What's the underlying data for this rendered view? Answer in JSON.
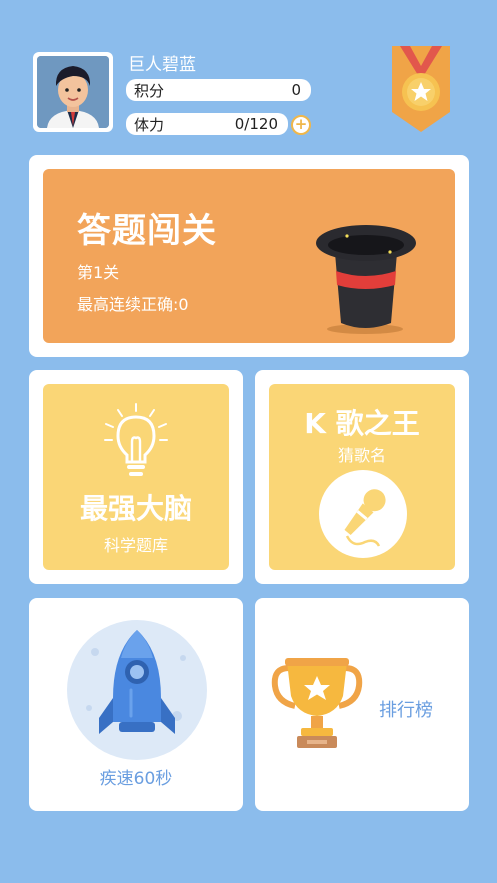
{
  "profile": {
    "username": "巨人碧蓝",
    "score_label": "积分",
    "score_value": "0",
    "stamina_label": "体力",
    "stamina_value": "0/120",
    "plus_symbol": "+"
  },
  "challenge": {
    "title": "答题闯关",
    "level": "第1关",
    "streak": "最高连续正确:0"
  },
  "brain": {
    "title": "最强大脑",
    "subtitle": "科学题库"
  },
  "ksong": {
    "title": "K 歌之王",
    "subtitle": "猜歌名"
  },
  "speed": {
    "label": "疾速60秒"
  },
  "rank": {
    "label": "排行榜"
  },
  "colors": {
    "background": "#8bbcec",
    "orange_card": "#f2a45a",
    "yellow_card": "#fad676",
    "blue_text": "#6a9ee0"
  },
  "icons": [
    "avatar",
    "medal-icon",
    "magic-hat-icon",
    "lightbulb-icon",
    "microphone-icon",
    "rocket-icon",
    "trophy-icon",
    "plus-icon"
  ]
}
